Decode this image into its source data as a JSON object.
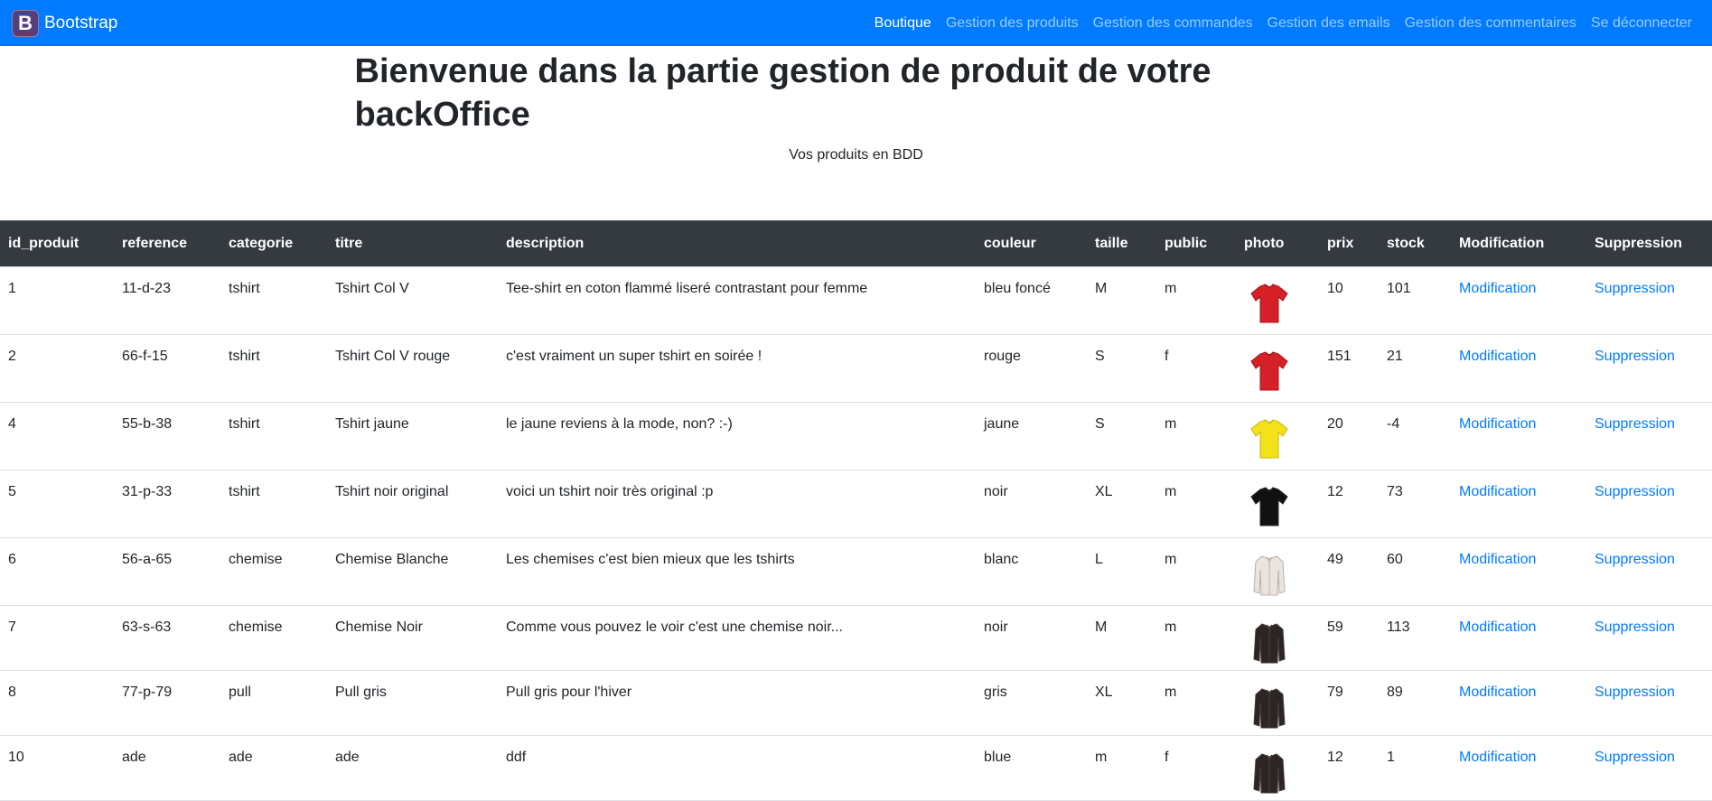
{
  "navbar": {
    "brand_letter": "B",
    "brand": "Bootstrap",
    "links": [
      {
        "label": "Boutique",
        "active": true
      },
      {
        "label": "Gestion des produits",
        "active": false
      },
      {
        "label": "Gestion des commandes",
        "active": false
      },
      {
        "label": "Gestion des emails",
        "active": false
      },
      {
        "label": "Gestion des commentaires",
        "active": false
      },
      {
        "label": "Se déconnecter",
        "active": false
      }
    ]
  },
  "page": {
    "title": "Bienvenue dans la partie gestion de produit de votre backOffice",
    "subtitle": "Vos produits en BDD"
  },
  "table": {
    "headers": [
      "id_produit",
      "reference",
      "categorie",
      "titre",
      "description",
      "couleur",
      "taille",
      "public",
      "photo",
      "prix",
      "stock",
      "Modification",
      "Suppression"
    ],
    "rows": [
      {
        "id": "1",
        "reference": "11-d-23",
        "categorie": "tshirt",
        "titre": "Tshirt Col V",
        "description": "Tee-shirt en coton flammé liseré contrastant pour femme",
        "couleur": "bleu foncé",
        "taille": "M",
        "public": "m",
        "photo": "red-tshirt",
        "prix": "10",
        "stock": "101",
        "modif": "Modification",
        "suppr": "Suppression"
      },
      {
        "id": "2",
        "reference": "66-f-15",
        "categorie": "tshirt",
        "titre": "Tshirt Col V rouge",
        "description": "c'est vraiment un super tshirt en soirée !",
        "couleur": "rouge",
        "taille": "S",
        "public": "f",
        "photo": "red-tshirt",
        "prix": "151",
        "stock": "21",
        "modif": "Modification",
        "suppr": "Suppression"
      },
      {
        "id": "4",
        "reference": "55-b-38",
        "categorie": "tshirt",
        "titre": "Tshirt jaune",
        "description": "le jaune reviens à la mode, non? :-)",
        "couleur": "jaune",
        "taille": "S",
        "public": "m",
        "photo": "yellow-tshirt",
        "prix": "20",
        "stock": "-4",
        "modif": "Modification",
        "suppr": "Suppression"
      },
      {
        "id": "5",
        "reference": "31-p-33",
        "categorie": "tshirt",
        "titre": "Tshirt noir original",
        "description": "voici un tshirt noir très original :p",
        "couleur": "noir",
        "taille": "XL",
        "public": "m",
        "photo": "black-tshirt",
        "prix": "12",
        "stock": "73",
        "modif": "Modification",
        "suppr": "Suppression"
      },
      {
        "id": "6",
        "reference": "56-a-65",
        "categorie": "chemise",
        "titre": "Chemise Blanche",
        "description": "Les chemises c'est bien mieux que les tshirts",
        "couleur": "blanc",
        "taille": "L",
        "public": "m",
        "photo": "white-shirt",
        "prix": "49",
        "stock": "60",
        "modif": "Modification",
        "suppr": "Suppression"
      },
      {
        "id": "7",
        "reference": "63-s-63",
        "categorie": "chemise",
        "titre": "Chemise Noir",
        "description": "Comme vous pouvez le voir c'est une chemise noir...",
        "couleur": "noir",
        "taille": "M",
        "public": "m",
        "photo": "dark-shirt",
        "prix": "59",
        "stock": "113",
        "modif": "Modification",
        "suppr": "Suppression"
      },
      {
        "id": "8",
        "reference": "77-p-79",
        "categorie": "pull",
        "titre": "Pull gris",
        "description": "Pull gris pour l'hiver",
        "couleur": "gris",
        "taille": "XL",
        "public": "m",
        "photo": "dark-shirt",
        "prix": "79",
        "stock": "89",
        "modif": "Modification",
        "suppr": "Suppression"
      },
      {
        "id": "10",
        "reference": "ade",
        "categorie": "ade",
        "titre": "ade",
        "description": "ddf",
        "couleur": "blue",
        "taille": "m",
        "public": "f",
        "photo": "dark-shirt",
        "prix": "12",
        "stock": "1",
        "modif": "Modification",
        "suppr": "Suppression"
      }
    ]
  },
  "colors": {
    "navbar": "#007bff",
    "thead": "#343a40",
    "link": "#007bff"
  }
}
